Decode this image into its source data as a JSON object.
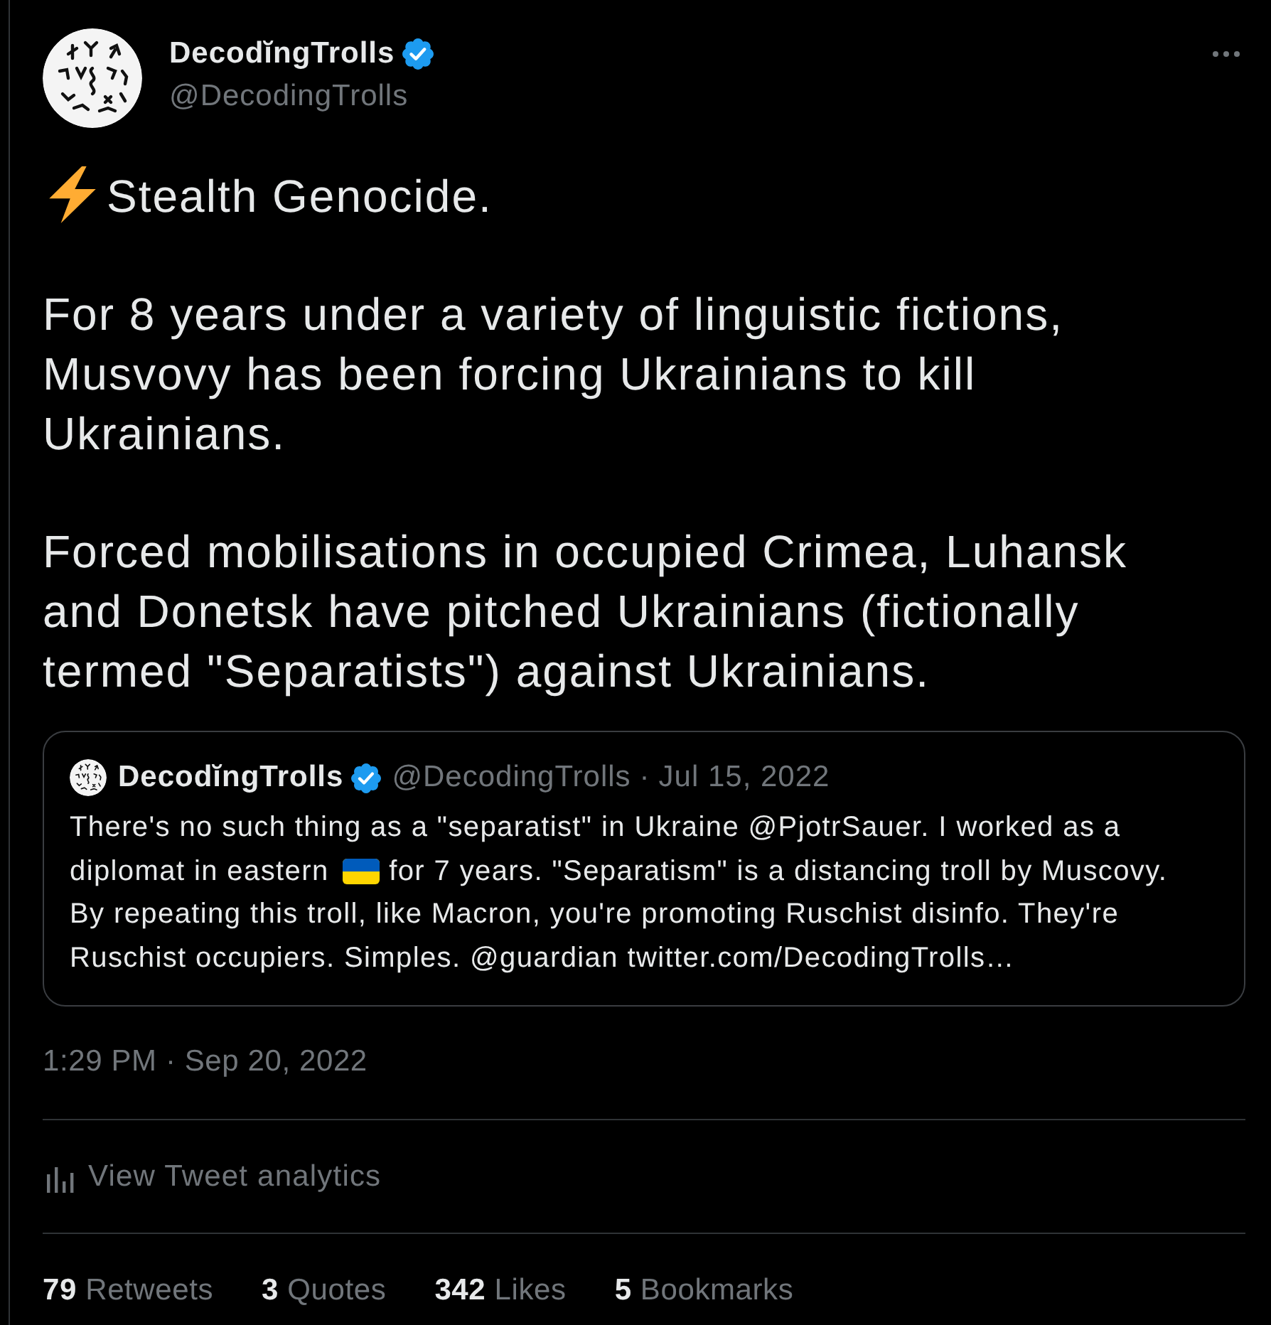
{
  "author": {
    "display_name": "DecodĭngTrolls",
    "handle": "@DecodingTrolls",
    "verified": true
  },
  "tweet": {
    "paragraphs": [
      {
        "kind": "icon_lead",
        "text": "Stealth Genocide."
      },
      {
        "kind": "plain",
        "text": "For 8 years under a variety of linguistic fictions, Musvovy has been forcing Ukrainians to kill Ukrainians."
      },
      {
        "kind": "plain",
        "text": "Forced mobilisations in occupied Crimea, Luhansk and Donetsk have pitched Ukrainians (fictionally termed \"Separatists\") against Ukrainians."
      }
    ]
  },
  "quote": {
    "display_name": "DecodĭngTrolls",
    "verified": true,
    "handle": "@DecodingTrolls",
    "separator": "·",
    "date": "Jul 15, 2022",
    "text_rows": [
      [
        "There's no such thing as a \"separatist\" in Ukraine @PjotrSauer. I worked as a"
      ],
      [
        "diplomat in eastern",
        "for 7 years. \"Separatism\" is a distancing troll by Muscovy."
      ],
      [
        "By repeating this troll, like Macron, you're promoting Ruschist disinfo. They're Ruschist occupiers. Simples. @guardian twitter.com/DecodingTrolls…"
      ]
    ]
  },
  "timestamp": "1:29 PM · Sep 20, 2022",
  "analytics": {
    "label": "View Tweet analytics"
  },
  "stats": [
    {
      "count": "79",
      "label": "Retweets"
    },
    {
      "count": "3",
      "label": "Quotes"
    },
    {
      "count": "342",
      "label": "Likes"
    },
    {
      "count": "5",
      "label": "Bookmarks"
    }
  ]
}
